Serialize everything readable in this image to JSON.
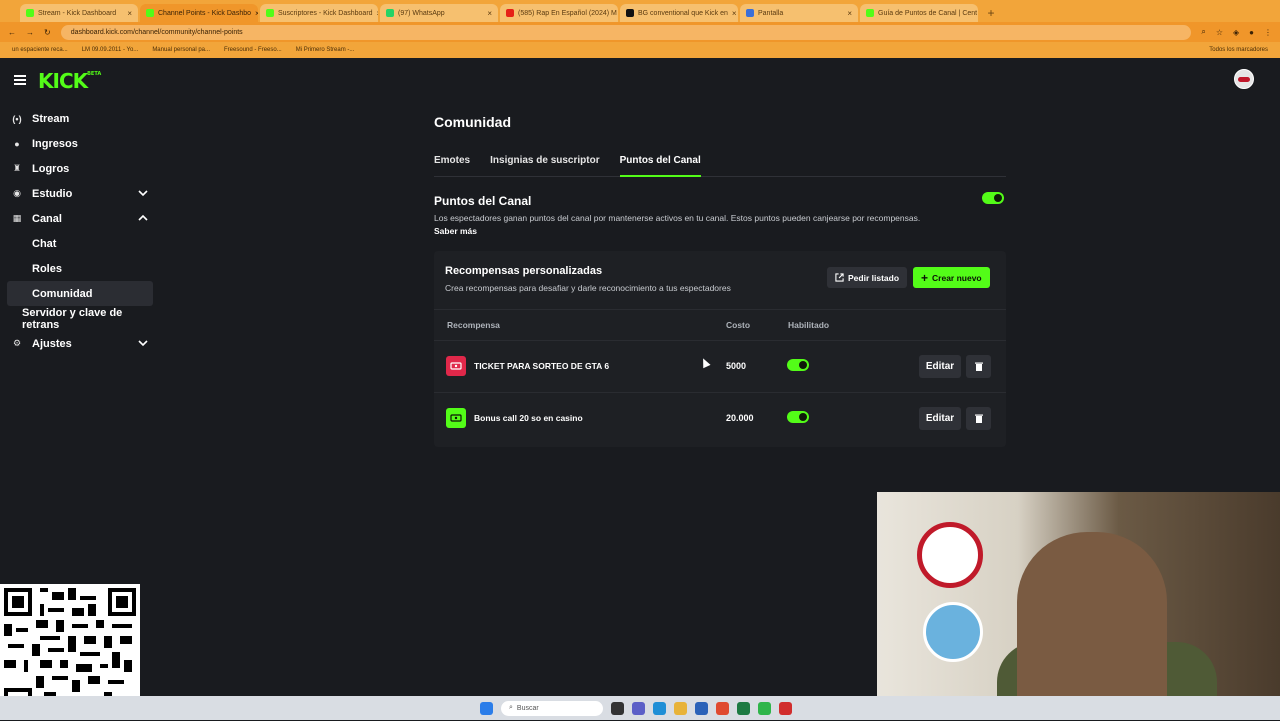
{
  "browser": {
    "tabs": [
      {
        "label": "Stream - Kick Dashboard",
        "active": false
      },
      {
        "label": "Channel Points - Kick Dashbo",
        "active": true
      },
      {
        "label": "Suscriptores - Kick Dashboard",
        "active": false
      },
      {
        "label": "(97) WhatsApp",
        "active": false
      },
      {
        "label": "(585) Rap En Español (2024) M",
        "active": false
      },
      {
        "label": "BG conventional que Kick en",
        "active": false
      },
      {
        "label": "Pantalla",
        "active": false
      },
      {
        "label": "Guía de Puntos de Canal | Cent",
        "active": false
      }
    ],
    "url": "dashboard.kick.com/channel/community/channel-points",
    "bookmarks": [
      "un espaciente reca...",
      "LM 09.09.2011 - Yo...",
      "Manual personal pa...",
      "Freesound - Freeso...",
      "Mi Primero Stream -..."
    ],
    "bookmarks_right": "Todos los marcadores"
  },
  "app": {
    "logo": "KICK",
    "logo_badge": "BETA"
  },
  "sidebar": {
    "items": [
      {
        "label": "Stream",
        "icon": "broadcast-icon",
        "glyph": "(•)"
      },
      {
        "label": "Ingresos",
        "icon": "money-icon",
        "glyph": "●"
      },
      {
        "label": "Logros",
        "icon": "trophy-icon",
        "glyph": "♜"
      },
      {
        "label": "Estudio",
        "icon": "studio-icon",
        "glyph": "◉"
      },
      {
        "label": "Canal",
        "icon": "channel-icon",
        "glyph": "▦"
      }
    ],
    "canal_sub": [
      {
        "label": "Chat"
      },
      {
        "label": "Roles"
      },
      {
        "label": "Comunidad"
      }
    ],
    "server_item": "Servidor y clave de retrans",
    "settings_item": {
      "label": "Ajustes",
      "glyph": "⚙"
    }
  },
  "main": {
    "title": "Comunidad",
    "tabs": [
      "Emotes",
      "Insignias de suscriptor",
      "Puntos del Canal"
    ],
    "section": {
      "title": "Puntos del Canal",
      "enabled": true,
      "description": "Los espectadores ganan puntos del canal por mantenerse activos en tu canal. Estos puntos pueden canjearse por recompensas.",
      "learn_more": "Saber más"
    },
    "rewards": {
      "title": "Recompensas personalizadas",
      "subtitle": "Crea recompensas para desafiar y darle reconocimiento a tus espectadores",
      "list_button": "Pedir listado",
      "create_button": "Crear nuevo",
      "columns": [
        "Recompensa",
        "Costo",
        "Habilitado"
      ],
      "rows": [
        {
          "name": "TICKET PARA SORTEO DE GTA 6",
          "cost": "5000",
          "enabled": true,
          "color": "#e0284a",
          "edit": "Editar"
        },
        {
          "name": "Bonus call 20 so en casino",
          "cost": "20.000",
          "enabled": true,
          "color": "#53fc18",
          "edit": "Editar"
        }
      ]
    }
  },
  "taskbar": {
    "search_placeholder": "Buscar"
  },
  "colors": {
    "accent": "#53fc18",
    "background": "#191b1f",
    "browser_chrome": "#f2a53a"
  }
}
